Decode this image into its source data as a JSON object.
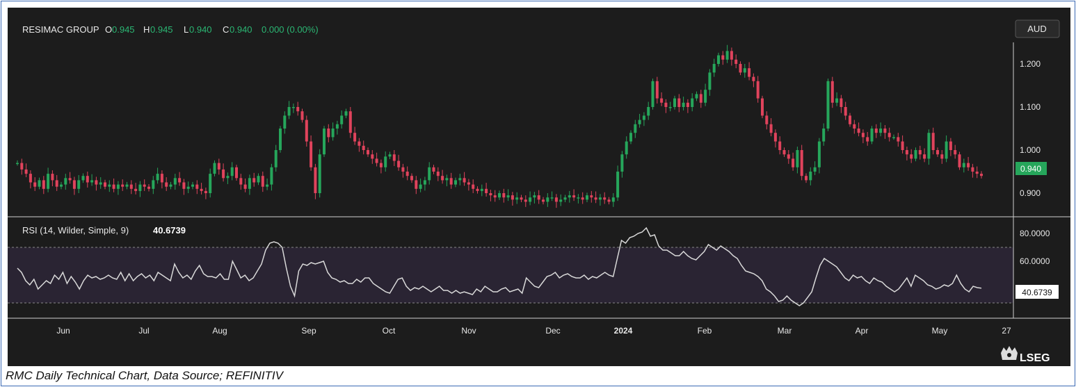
{
  "header": {
    "instrument": "RESIMAC GROUP",
    "open_label": "O",
    "open_value": "0.945",
    "high_label": "H",
    "high_value": "0.945",
    "low_label": "L",
    "low_value": "0.940",
    "close_label": "C",
    "close_value": "0.940",
    "change": "0.000 (0.00%)"
  },
  "currency_button": "AUD",
  "last_price_label": "0.940",
  "rsi_header": {
    "label": "RSI (14, Wilder, Simple, 9)",
    "value": "40.6739"
  },
  "rsi_last_label": "40.6739",
  "caption": "RMC Daily Technical Chart, Data Source; REFINITIV",
  "brand": "LSEG",
  "colors": {
    "up": "#26a65b",
    "down": "#e0435c",
    "rsi_line": "#d9d9d9",
    "background": "#1c1c1c",
    "header_values": "#2bb673",
    "rsi_band": "#2a2433"
  },
  "icons": [
    "lseg-crest-icon"
  ],
  "chart_data": [
    {
      "type": "candlestick",
      "title": "RESIMAC GROUP",
      "ylim": [
        0.85,
        1.25
      ],
      "y_ticks": [
        1.2,
        1.1,
        1.0,
        0.9
      ],
      "y_tick_labels": [
        "1.200",
        "1.100",
        "1.000",
        "0.900"
      ],
      "x_tick_labels": [
        "Jun",
        "Jul",
        "Aug",
        "Sep",
        "Oct",
        "Nov",
        "Dec",
        "2024",
        "Feb",
        "Mar",
        "Apr",
        "May",
        "27"
      ],
      "last_close": 0.94,
      "closes": [
        0.97,
        0.955,
        0.945,
        0.925,
        0.915,
        0.93,
        0.91,
        0.945,
        0.93,
        0.915,
        0.92,
        0.935,
        0.93,
        0.91,
        0.93,
        0.94,
        0.925,
        0.93,
        0.92,
        0.925,
        0.915,
        0.92,
        0.91,
        0.92,
        0.915,
        0.92,
        0.91,
        0.905,
        0.92,
        0.915,
        0.91,
        0.93,
        0.945,
        0.925,
        0.915,
        0.92,
        0.935,
        0.925,
        0.91,
        0.915,
        0.92,
        0.91,
        0.905,
        0.9,
        0.945,
        0.97,
        0.955,
        0.935,
        0.94,
        0.96,
        0.935,
        0.92,
        0.91,
        0.935,
        0.925,
        0.94,
        0.915,
        0.92,
        0.96,
        1.0,
        1.05,
        1.08,
        1.1,
        1.1,
        1.09,
        1.07,
        1.02,
        0.96,
        0.9,
        0.99,
        1.05,
        1.03,
        1.05,
        1.06,
        1.08,
        1.09,
        1.04,
        1.02,
        1.01,
        1.0,
        0.99,
        0.98,
        0.97,
        0.96,
        0.985,
        0.99,
        0.975,
        0.96,
        0.95,
        0.94,
        0.93,
        0.91,
        0.92,
        0.93,
        0.96,
        0.95,
        0.94,
        0.93,
        0.935,
        0.92,
        0.93,
        0.935,
        0.925,
        0.92,
        0.91,
        0.905,
        0.91,
        0.9,
        0.895,
        0.89,
        0.9,
        0.89,
        0.895,
        0.885,
        0.89,
        0.885,
        0.88,
        0.89,
        0.895,
        0.885,
        0.88,
        0.89,
        0.89,
        0.88,
        0.885,
        0.89,
        0.895,
        0.89,
        0.89,
        0.885,
        0.895,
        0.89,
        0.885,
        0.89,
        0.885,
        0.88,
        0.89,
        0.95,
        0.99,
        1.02,
        1.04,
        1.06,
        1.07,
        1.08,
        1.1,
        1.16,
        1.12,
        1.11,
        1.1,
        1.1,
        1.12,
        1.1,
        1.11,
        1.1,
        1.12,
        1.13,
        1.11,
        1.14,
        1.18,
        1.2,
        1.22,
        1.21,
        1.23,
        1.21,
        1.2,
        1.18,
        1.19,
        1.17,
        1.16,
        1.12,
        1.08,
        1.06,
        1.04,
        1.02,
        1.0,
        0.99,
        0.98,
        0.96,
        1.0,
        0.94,
        0.93,
        0.95,
        0.96,
        1.02,
        1.05,
        1.16,
        1.11,
        1.12,
        1.1,
        1.08,
        1.06,
        1.05,
        1.04,
        1.03,
        1.02,
        1.05,
        1.04,
        1.05,
        1.04,
        1.03,
        1.03,
        1.02,
        1.0,
        0.99,
        0.98,
        1.0,
        0.99,
        0.98,
        1.04,
        1.0,
        0.99,
        0.98,
        1.02,
        1.0,
        0.99,
        0.96,
        0.97,
        0.96,
        0.95,
        0.945,
        0.94
      ]
    },
    {
      "type": "line",
      "title": "RSI (14, Wilder, Simple, 9)",
      "ylim": [
        20,
        90
      ],
      "y_ticks": [
        80,
        60
      ],
      "y_tick_labels": [
        "80.0000",
        "60.0000"
      ],
      "band": [
        30,
        70
      ],
      "last_value": 40.6739,
      "values": [
        55,
        52,
        46,
        43,
        47,
        40,
        43,
        46,
        44,
        50,
        47,
        52,
        44,
        49,
        45,
        40,
        46,
        50,
        48,
        49,
        47,
        48,
        50,
        48,
        47,
        52,
        46,
        51,
        46,
        49,
        51,
        48,
        50,
        46,
        52,
        50,
        48,
        46,
        58,
        52,
        48,
        50,
        47,
        53,
        57,
        51,
        49,
        49,
        48,
        51,
        47,
        47,
        60,
        54,
        48,
        50,
        46,
        48,
        53,
        58,
        68,
        73,
        74,
        73,
        70,
        55,
        42,
        35,
        53,
        58,
        57,
        59,
        58,
        59,
        60,
        52,
        48,
        47,
        45,
        46,
        44,
        44,
        47,
        45,
        48,
        48,
        44,
        42,
        40,
        38,
        37,
        42,
        47,
        48,
        42,
        39,
        41,
        40,
        42,
        40,
        38,
        40,
        42,
        39,
        39,
        37,
        39,
        37,
        38,
        37,
        36,
        40,
        38,
        42,
        40,
        38,
        38,
        40,
        41,
        38,
        39,
        40,
        37,
        48,
        45,
        42,
        41,
        45,
        49,
        50,
        52,
        48,
        50,
        51,
        49,
        48,
        48,
        50,
        47,
        49,
        48,
        50,
        52,
        50,
        49,
        62,
        75,
        73,
        77,
        78,
        80,
        81,
        84,
        78,
        79,
        71,
        68,
        68,
        66,
        64,
        64,
        67,
        64,
        62,
        61,
        64,
        67,
        72,
        70,
        68,
        71,
        69,
        67,
        64,
        62,
        57,
        53,
        52,
        51,
        49,
        46,
        40,
        38,
        35,
        31,
        32,
        35,
        32,
        30,
        28,
        30,
        34,
        38,
        48,
        57,
        62,
        60,
        58,
        56,
        52,
        48,
        46,
        50,
        48,
        49,
        46,
        44,
        48,
        46,
        45,
        42,
        40,
        38,
        40,
        44,
        48,
        42,
        50,
        48,
        46,
        43,
        42,
        40,
        41,
        43,
        42,
        44,
        50,
        44,
        40,
        38,
        42,
        41,
        40.6739
      ]
    }
  ]
}
